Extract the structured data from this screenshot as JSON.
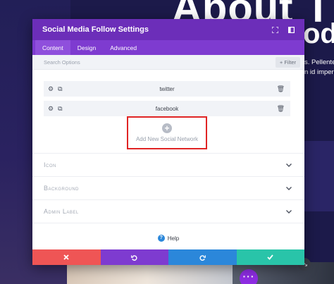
{
  "background": {
    "heading_line1": "About The",
    "heading_line2": "od",
    "text_line1": "s. Pellente",
    "text_line2": "n id imperd"
  },
  "modal": {
    "title": "Social Media Follow Settings",
    "expand_icon": "expand-icon",
    "sidebar_icon": "sidebar-icon",
    "tabs": [
      {
        "label": "Content",
        "active": true
      },
      {
        "label": "Design",
        "active": false
      },
      {
        "label": "Advanced",
        "active": false
      }
    ],
    "search": {
      "placeholder": "Search Options",
      "filter_label": "+ Filter"
    },
    "networks": [
      {
        "label": "twitter"
      },
      {
        "label": "facebook"
      }
    ],
    "add_network_label": "Add New Social Network",
    "toggles": [
      {
        "title": "Icon"
      },
      {
        "title": "Background"
      },
      {
        "title": "Admin Label"
      }
    ],
    "help_label": "Help",
    "footer": {
      "cancel_icon": "close-icon",
      "undo_icon": "undo-icon",
      "redo_icon": "redo-icon",
      "save_icon": "check-icon"
    }
  },
  "colors": {
    "header": "#6c2eb9",
    "tabs": "#7e3bd0",
    "cancel": "#ef5555",
    "undo": "#7e3bd0",
    "redo": "#2b87da",
    "save": "#29c4a9",
    "highlight_box": "#e02424"
  }
}
